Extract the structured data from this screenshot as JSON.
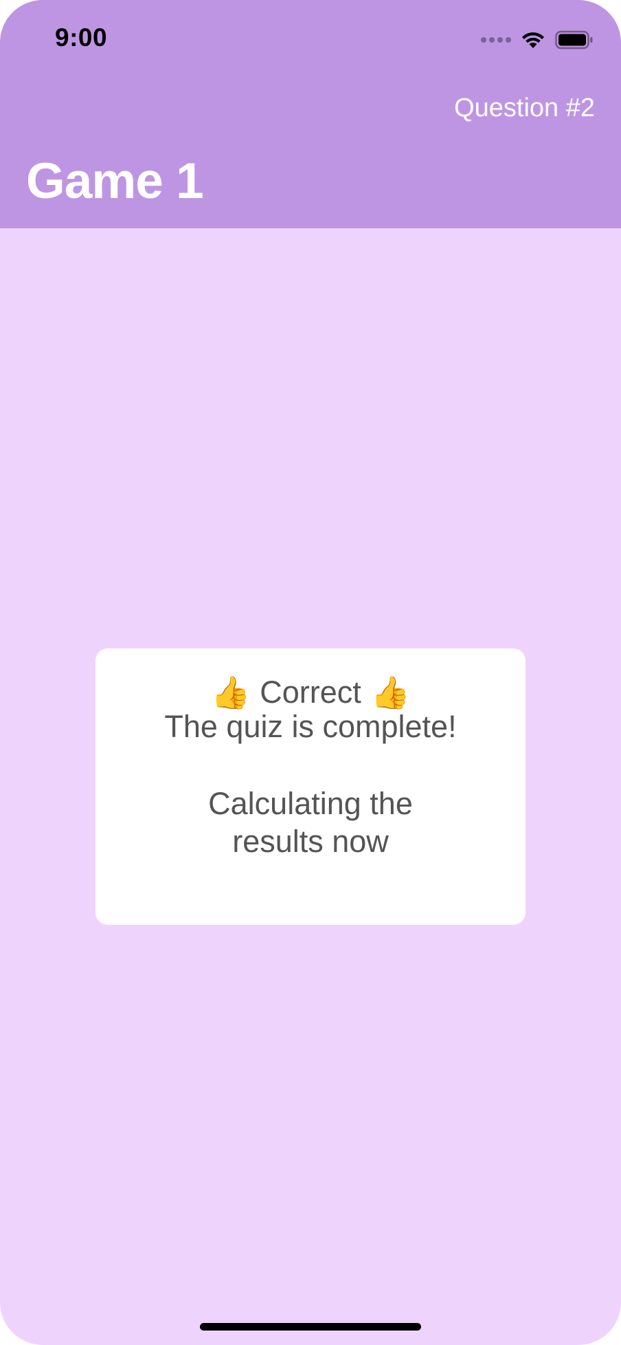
{
  "status_bar": {
    "time": "9:00"
  },
  "header": {
    "question_label": "Question #2",
    "title": "Game 1",
    "background_color": "#BE95E3"
  },
  "main": {
    "background_color": "#EED4FD",
    "card": {
      "heading": "Correct",
      "heading_icon": "thumbs-up-icon",
      "message": "The quiz is complete!",
      "status_line_1": "Calculating the",
      "status_line_2": "results now"
    }
  }
}
